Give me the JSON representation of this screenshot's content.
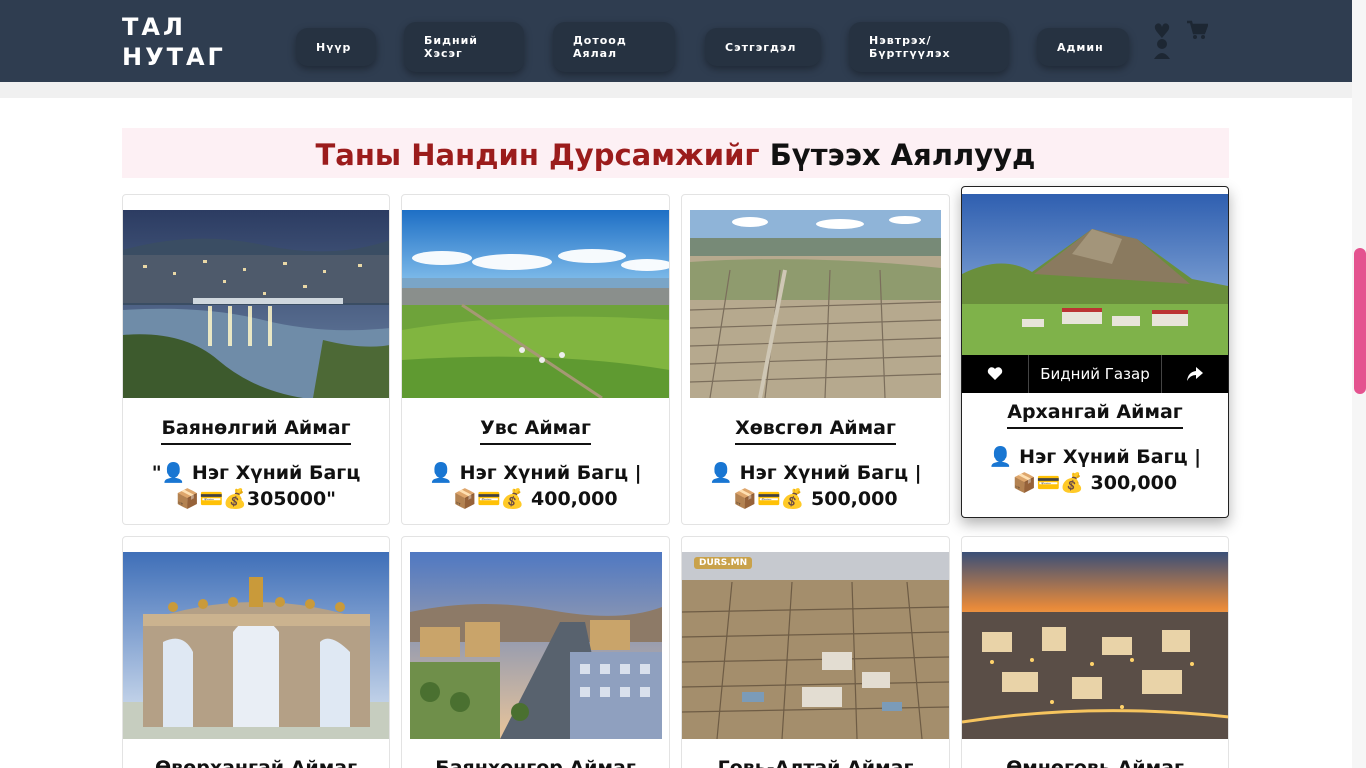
{
  "brand": {
    "line1": "ТАЛ",
    "line2": "НУТАГ"
  },
  "nav": [
    {
      "label": "Нүүр"
    },
    {
      "label": "Бидний Хэсэг"
    },
    {
      "label": "Дотоод Аялал"
    },
    {
      "label": "Сэтгэгдэл"
    },
    {
      "label": "Нэвтрэх/ Бүртгүүлэх"
    },
    {
      "label": "Админ"
    }
  ],
  "header_icons": [
    "heart-icon",
    "cart-icon",
    "user-icon"
  ],
  "section_title": {
    "part1": "Таны Нандин Дурсамжийг",
    "part2": "Бүтээх Аяллууд"
  },
  "overlay": {
    "center_label": "Бидний Газар",
    "left_icon": "heart-icon",
    "right_icon": "share-icon"
  },
  "cards": [
    {
      "name": "Баянөлгий Аймаг",
      "price_line1": "\"👤 Нэг Хүний Багц",
      "price_line2": "📦💳💰305000\""
    },
    {
      "name": "Увс Аймаг",
      "price_line1": "👤 Нэг Хүний Багц |",
      "price_line2": "📦💳💰 400,000"
    },
    {
      "name": "Хөвсгөл Аймаг",
      "price_line1": "👤 Нэг Хүний Багц |",
      "price_line2": "📦💳💰 500,000"
    },
    {
      "name": "Архангай Аймаг",
      "price_line1": "👤 Нэг Хүний Багц |",
      "price_line2": "📦💳💰 300,000"
    },
    {
      "name": "Өвөрхангай Аймаг"
    },
    {
      "name": "Баянхонгор Аймаг"
    },
    {
      "name": "Говь-Алтай Аймаг"
    },
    {
      "name": "Өмнөговь Аймаг"
    }
  ],
  "watermark": {
    "text": "DURS.MN"
  },
  "colors": {
    "header": "#2f3d50",
    "accent_title": "#9b1c1c",
    "scroll_thumb": "#e4538f"
  }
}
